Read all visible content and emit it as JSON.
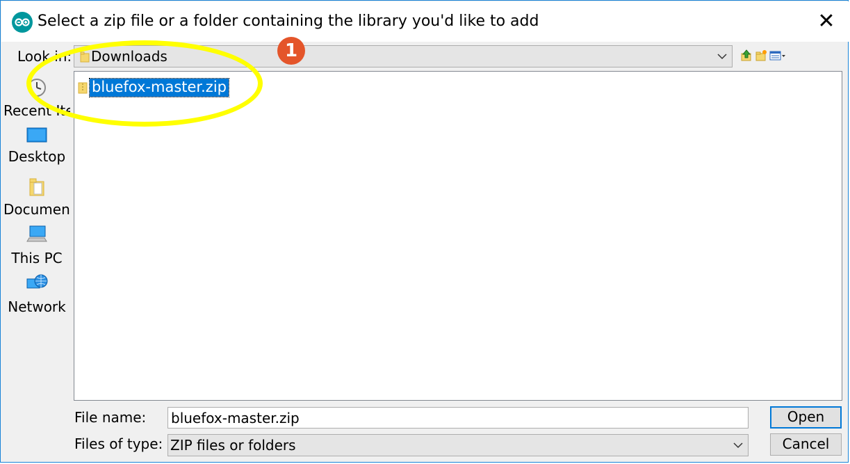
{
  "window": {
    "title": "Select a zip file or a folder containing the library you'd like to add",
    "close_glyph": "✕",
    "app_icon": "arduino-icon"
  },
  "look_in": {
    "label": "Look in:",
    "value": "Downloads"
  },
  "places": [
    {
      "label": "Recent Items",
      "icon": "recent-icon"
    },
    {
      "label": "Desktop",
      "icon": "desktop-icon"
    },
    {
      "label": "Documents",
      "icon": "documents-icon"
    },
    {
      "label": "This PC",
      "icon": "computer-icon"
    },
    {
      "label": "Network",
      "icon": "network-icon"
    }
  ],
  "files": [
    {
      "name": "bluefox-master.zip",
      "selected": true
    }
  ],
  "file_name": {
    "label": "File name:",
    "value": "bluefox-master.zip"
  },
  "file_type": {
    "label": "Files of type:",
    "value": "ZIP files or folders"
  },
  "buttons": {
    "open": "Open",
    "cancel": "Cancel"
  },
  "annotation": {
    "marker": "1",
    "highlight_color": "#ffff00",
    "marker_color": "#e4552a"
  },
  "colors": {
    "selection": "#0078d7",
    "accent_border": "#1883d7"
  }
}
